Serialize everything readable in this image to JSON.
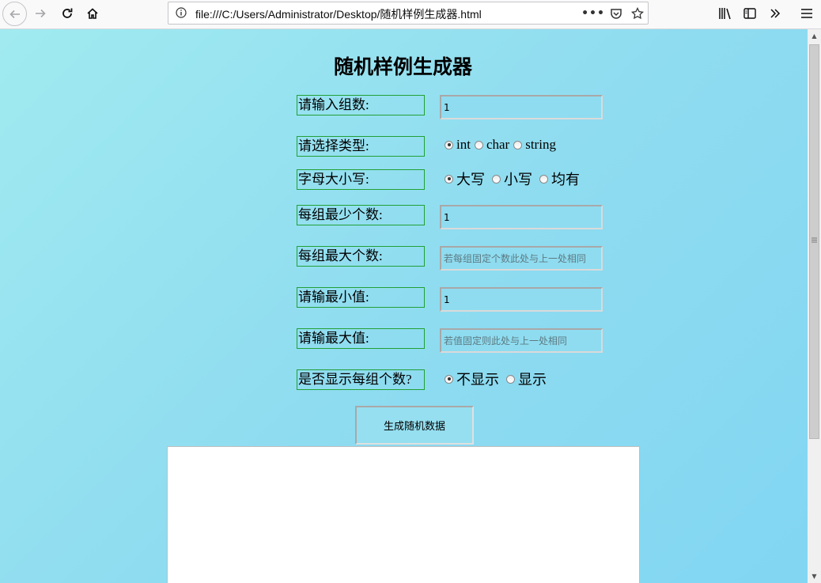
{
  "browser": {
    "url": "file:///C:/Users/Administrator/Desktop/随机样例生成器.html",
    "icons": {
      "back": "back-arrow-icon",
      "forward": "forward-arrow-icon",
      "reload": "reload-icon",
      "home": "home-icon",
      "info": "info-icon",
      "more": "more-dots-icon",
      "pocket": "pocket-icon",
      "bookmark": "star-icon",
      "library": "library-icon",
      "sidebar": "sidebar-icon",
      "overflow": "overflow-chevron-icon",
      "menu": "hamburger-menu-icon"
    }
  },
  "page": {
    "title": "随机样例生成器",
    "fields": {
      "group_count": {
        "label": "请输入组数:",
        "value": "1"
      },
      "type": {
        "label": "请选择类型:",
        "options": [
          "int",
          "char",
          "string"
        ],
        "selected": "int"
      },
      "case": {
        "label": "字母大小写:",
        "options": [
          "大写",
          "小写",
          "均有"
        ],
        "selected": "大写"
      },
      "min_count": {
        "label": "每组最少个数:",
        "value": "1"
      },
      "max_count": {
        "label": "每组最大个数:",
        "placeholder": "若每组固定个数此处与上一处相同"
      },
      "min_value": {
        "label": "请输最小值:",
        "value": "1"
      },
      "max_value": {
        "label": "请输最大值:",
        "placeholder": "若值固定则此处与上一处相同"
      },
      "show_count": {
        "label": "是否显示每组个数?",
        "options": [
          "不显示",
          "显示"
        ],
        "selected": "不显示"
      }
    },
    "generate_button": "生成随机数据",
    "output": ""
  },
  "colors": {
    "background_start": "#a0eaf0",
    "background_end": "#82d6f2",
    "label_border": "#22a035",
    "output_bg": "#ffffff"
  }
}
